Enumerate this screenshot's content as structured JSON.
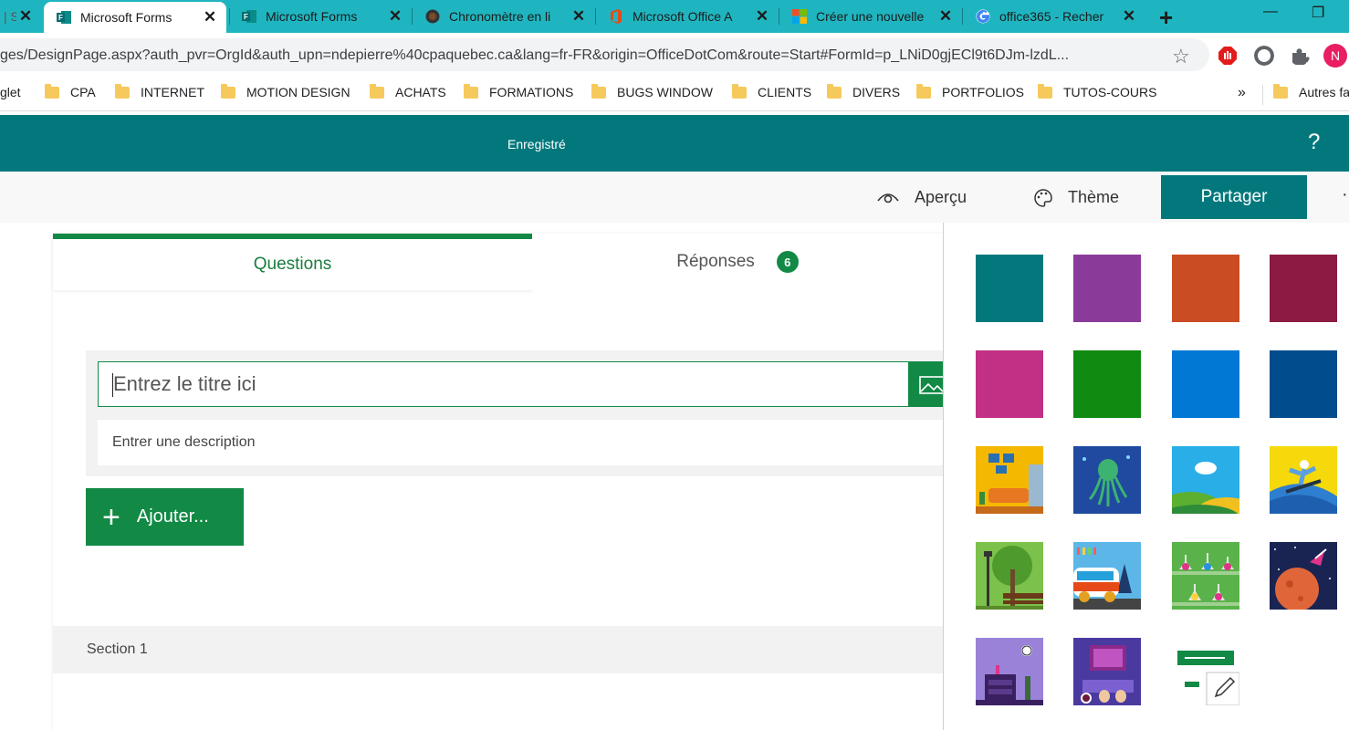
{
  "browser": {
    "tabs": [
      {
        "title": "| S",
        "favicon": "partial"
      },
      {
        "title": "Microsoft Forms",
        "favicon": "forms-icon",
        "active": true
      },
      {
        "title": "Microsoft Forms",
        "favicon": "forms-icon"
      },
      {
        "title": "Chronomètre en li",
        "favicon": "stopwatch-icon"
      },
      {
        "title": "Microsoft Office A",
        "favicon": "office-icon"
      },
      {
        "title": "Créer une nouvelle",
        "favicon": "windows-icon"
      },
      {
        "title": "office365 - Recher",
        "favicon": "google-icon"
      }
    ],
    "url": "ges/DesignPage.aspx?auth_pvr=OrgId&auth_upn=ndepierre%40cpaquebec.ca&lang=fr-FR&origin=OfficeDotCom&route=Start#FormId=p_LNiD0gjECl9t6DJm-lzdL...",
    "profile_initial": "N",
    "bookmarks": [
      "glet",
      "CPA",
      "INTERNET",
      "MOTION DESIGN",
      "ACHATS",
      "FORMATIONS",
      "BUGS WINDOW",
      "CLIENTS",
      "DIVERS",
      "PORTFOLIOS",
      "TUTOS-COURS"
    ],
    "bookmarks_more": "»",
    "other_bookmarks": "Autres fa"
  },
  "header": {
    "status": "Enregistré",
    "help": "?"
  },
  "toolbar": {
    "preview": "Aperçu",
    "theme": "Thème",
    "share": "Partager",
    "more": "·"
  },
  "form": {
    "tab_questions": "Questions",
    "tab_responses": "Réponses",
    "responses_count": "6",
    "title_placeholder": "Entrez le titre ici",
    "description_placeholder": "Entrer une description",
    "add_button": "Ajouter...",
    "section_label": "Section 1"
  },
  "theme_panel": {
    "colors": [
      "#03787c",
      "#8a3b9a",
      "#ca4c23",
      "#8c1a43",
      "#c13085",
      "#108a10",
      "#0078d4",
      "#004c8c"
    ],
    "image_themes": [
      "living-room-theme",
      "octopus-theme",
      "hills-theme",
      "snowboard-theme",
      "park-theme",
      "van-theme",
      "lab-theme",
      "space-theme",
      "desk-theme",
      "typing-theme"
    ],
    "custom_theme": "custom-theme-icon"
  }
}
